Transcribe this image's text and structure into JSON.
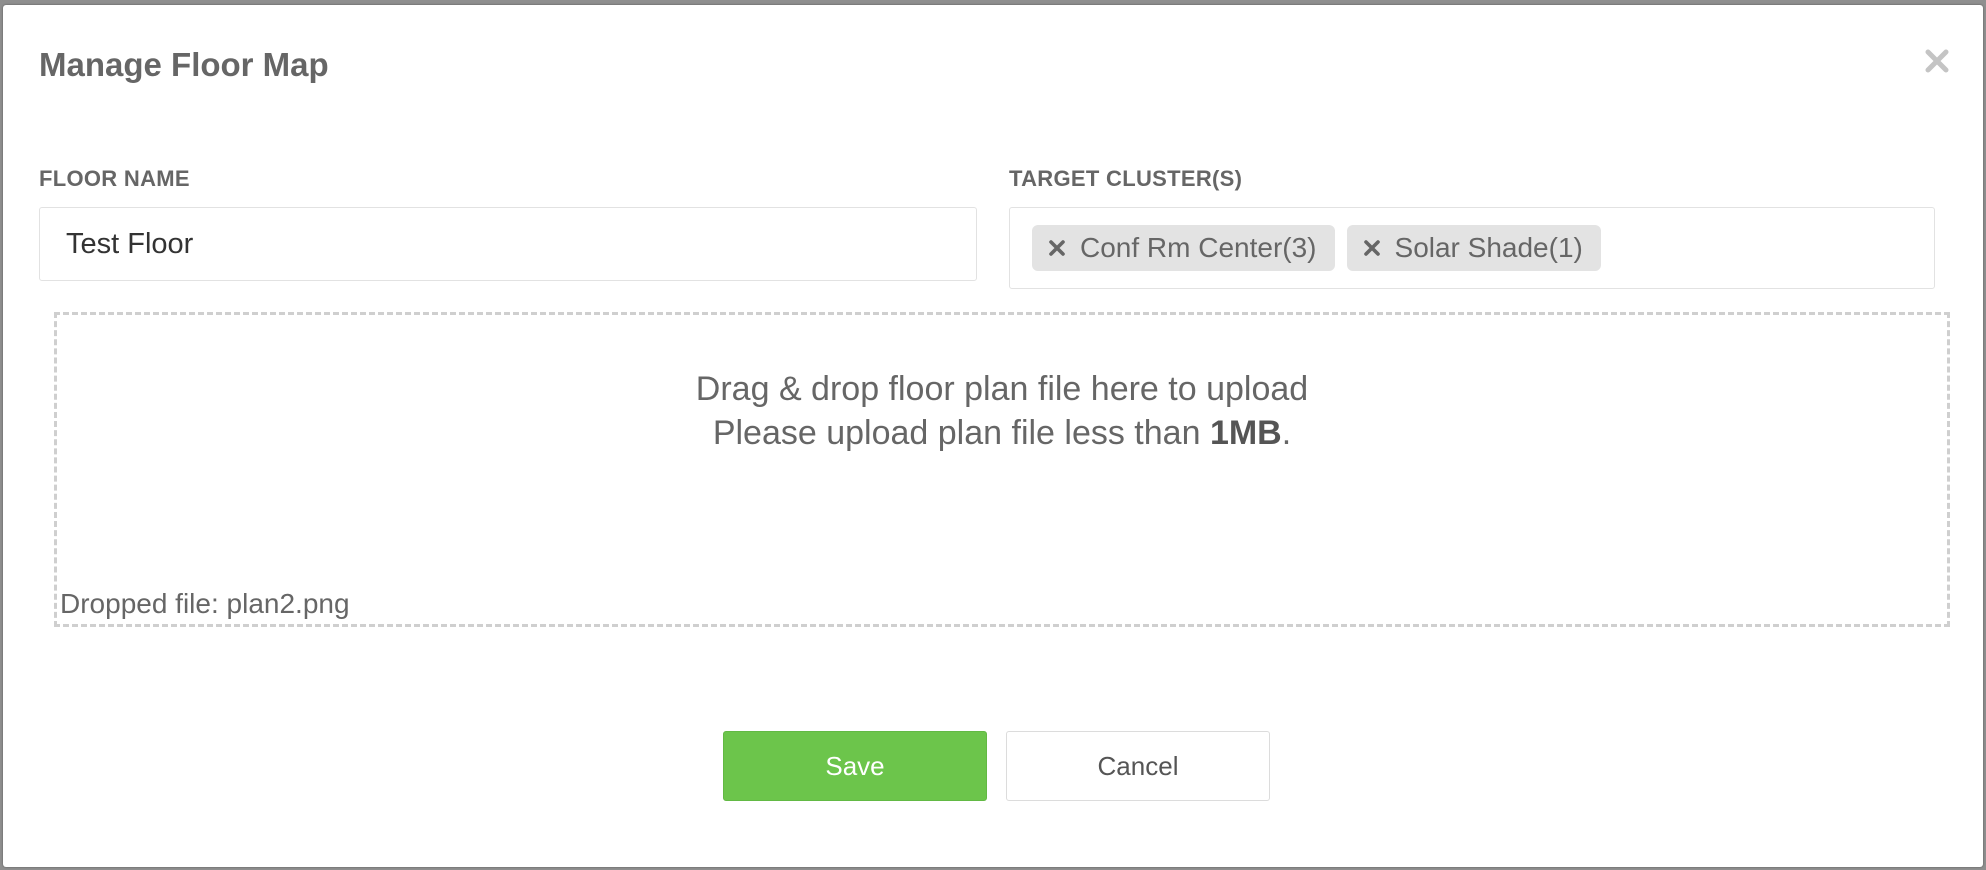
{
  "modal": {
    "title": "Manage Floor Map",
    "close_icon": "close-icon"
  },
  "floor_name": {
    "label": "FLOOR NAME",
    "value": "Test Floor"
  },
  "target_clusters": {
    "label": "TARGET CLUSTER(S)",
    "tags": [
      {
        "label": "Conf Rm Center(3)"
      },
      {
        "label": "Solar Shade(1)"
      }
    ]
  },
  "dropzone": {
    "line1": "Drag & drop floor plan file here to upload",
    "line2_prefix": "Please upload plan file less than ",
    "line2_bold": "1MB",
    "line2_suffix": ".",
    "dropped_file": "Dropped file: plan2.png"
  },
  "actions": {
    "save_label": "Save",
    "cancel_label": "Cancel"
  },
  "colors": {
    "primary_green": "#6cc54b",
    "text_gray": "#666666",
    "tag_bg": "#e3e3e3"
  }
}
